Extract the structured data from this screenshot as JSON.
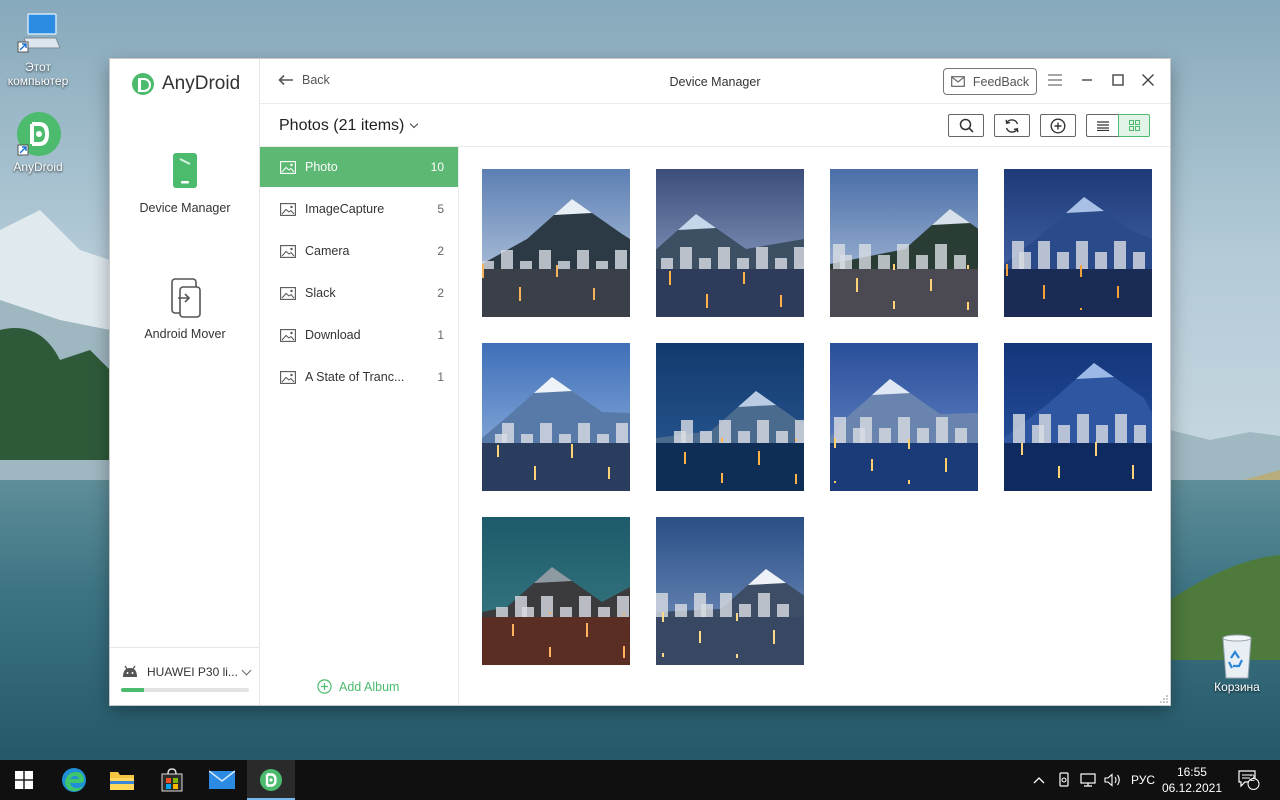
{
  "desktop": {
    "icons": [
      {
        "label": "Этот компьютер",
        "icon": "computer-icon"
      },
      {
        "label": "AnyDroid",
        "icon": "anydroid-icon"
      },
      {
        "label": "Корзина",
        "icon": "recycle-bin-icon"
      }
    ]
  },
  "app": {
    "brand": "AnyDroid",
    "accent": "#4cbb6e",
    "nav": [
      {
        "label": "Device Manager",
        "icon": "phone-icon"
      },
      {
        "label": "Android Mover",
        "icon": "transfer-icon"
      }
    ],
    "device": {
      "name": "HUAWEI P30 li...",
      "storage_fraction": 0.18
    }
  },
  "topbar": {
    "back_label": "Back",
    "title": "Device Manager",
    "feedback_label": "FeedBack"
  },
  "toolbar": {
    "album_title": "Photos (21 items)",
    "view_mode": "grid"
  },
  "albums": {
    "items": [
      {
        "name": "Photo",
        "count": "10"
      },
      {
        "name": "ImageCapture",
        "count": "5"
      },
      {
        "name": "Camera",
        "count": "2"
      },
      {
        "name": "Slack",
        "count": "2"
      },
      {
        "name": "Download",
        "count": "1"
      },
      {
        "name": "A State of Tranc...",
        "count": "1"
      }
    ],
    "add_label": "Add Album"
  },
  "photos": {
    "count": 10
  },
  "taskbar": {
    "language": "РУС",
    "time": "16:55",
    "date": "06.12.2021",
    "notifications": "2"
  }
}
